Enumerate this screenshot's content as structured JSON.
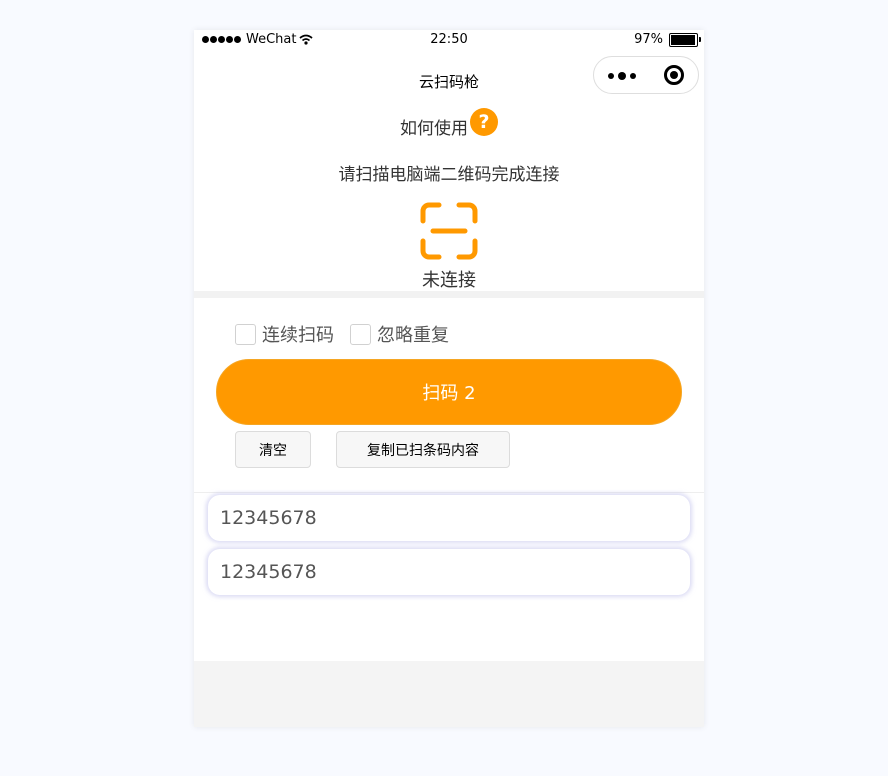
{
  "status_bar": {
    "carrier": "WeChat",
    "time": "22:50",
    "battery_percent": "97%"
  },
  "nav": {
    "title": "云扫码枪"
  },
  "header": {
    "how_to_use": "如何使用",
    "instruction": "请扫描电脑端二维码完成连接",
    "connection_status": "未连接"
  },
  "options": {
    "continuous_scan": "连续扫码",
    "ignore_duplicates": "忽略重复"
  },
  "actions": {
    "scan_label": "扫码 2",
    "clear_label": "清空",
    "copy_label": "复制已扫条码内容"
  },
  "results": [
    "12345678",
    "12345678"
  ],
  "colors": {
    "accent": "#ff9900"
  },
  "icons": {
    "help": "question-mark-icon",
    "scan": "scan-frame-icon",
    "more": "more-dots-icon",
    "close": "target-close-icon"
  }
}
